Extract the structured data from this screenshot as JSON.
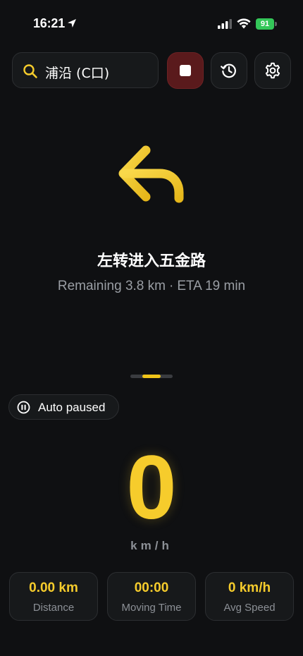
{
  "status_bar": {
    "time": "16:21",
    "battery_level": "91",
    "icons": [
      "location-arrow-icon",
      "cellular-signal-icon",
      "wifi-icon",
      "battery-charging-icon"
    ]
  },
  "search": {
    "value": "浦沿 (C口)",
    "icon": "search-icon"
  },
  "toolbar": {
    "stop_icon": "stop-icon",
    "history_icon": "history-icon",
    "settings_icon": "gear-icon"
  },
  "navigation": {
    "maneuver_icon": "turn-left-icon",
    "instruction": "左转进入五金路",
    "remaining": "Remaining 3.8 km",
    "separator": "·",
    "eta": "ETA 19 min"
  },
  "pager": {
    "pages": 2,
    "active_index": 0
  },
  "status_badge": {
    "icon": "pause-icon",
    "label": "Auto paused"
  },
  "speed": {
    "value": "0",
    "unit": "km/h"
  },
  "stats": [
    {
      "value": "0.00 km",
      "label": "Distance"
    },
    {
      "value": "00:00",
      "label": "Moving Time"
    },
    {
      "value": "0 km/h",
      "label": "Avg Speed"
    }
  ],
  "colors": {
    "background": "#0f1012",
    "accent": "#f6cc2c",
    "stop_button": "#5a1a1c",
    "muted_text": "#9a9ea4",
    "battery": "#34c759"
  }
}
